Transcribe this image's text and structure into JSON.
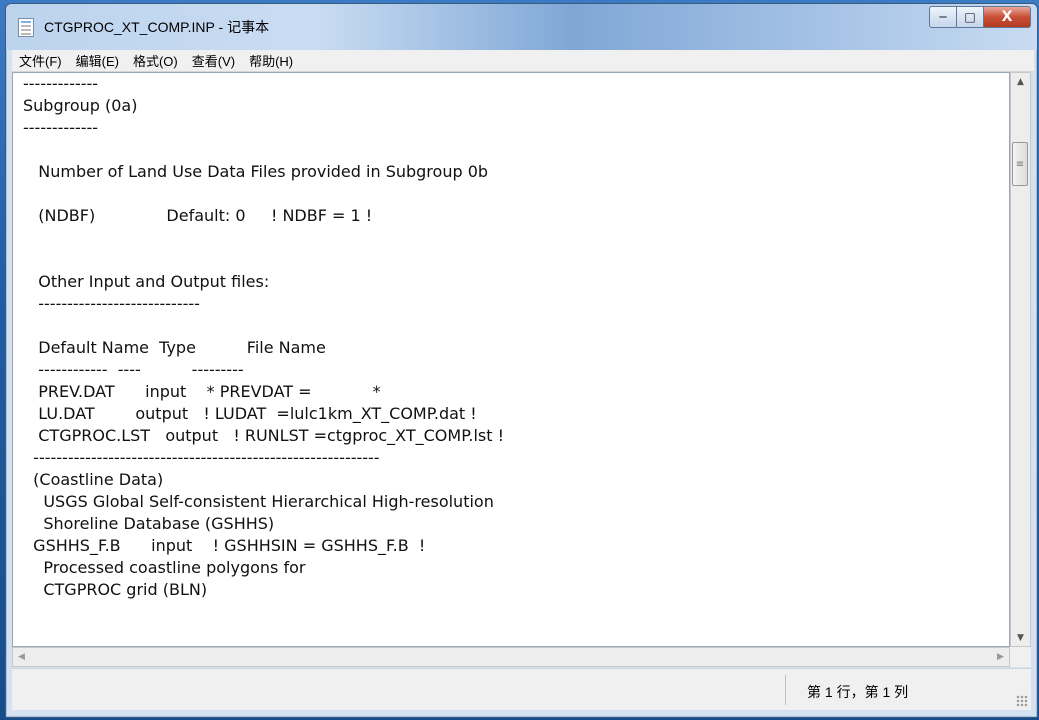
{
  "window": {
    "title": "CTGPROC_XT_COMP.INP - 记事本",
    "caption": {
      "minimize": "─",
      "maximize": "□",
      "close": "X"
    }
  },
  "menu": [
    {
      "label": "文件(F)"
    },
    {
      "label": "编辑(E)"
    },
    {
      "label": "格式(O)"
    },
    {
      "label": "查看(V)"
    },
    {
      "label": "帮助(H)"
    }
  ],
  "editor": {
    "lines": [
      "-------------",
      "Subgroup (0a)",
      "-------------",
      "",
      "   Number of Land Use Data Files provided in Subgroup 0b",
      "",
      "   (NDBF)              Default: 0     ! NDBF = 1 !",
      "",
      "",
      "   Other Input and Output files:",
      "   ----------------------------",
      "",
      "   Default Name  Type          File Name",
      "   ------------  ----          ---------",
      "   PREV.DAT      input    * PREVDAT =            *",
      "   LU.DAT        output   ! LUDAT  =lulc1km_XT_COMP.dat !",
      "   CTGPROC.LST   output   ! RUNLST =ctgproc_XT_COMP.lst !",
      "  ------------------------------------------------------------",
      "  (Coastline Data)",
      "    USGS Global Self-consistent Hierarchical High-resolution",
      "    Shoreline Database (GSHHS)",
      "  GSHHS_F.B      input    ! GSHHSIN = GSHHS_F.B  !",
      "    Processed coastline polygons for",
      "    CTGPROC grid (BLN)"
    ]
  },
  "scrollbar": {
    "up": "▲",
    "down": "▼",
    "left": "◀",
    "right": "▶",
    "grip": "≡"
  },
  "status": {
    "position": "第 1 行，第 1 列"
  }
}
